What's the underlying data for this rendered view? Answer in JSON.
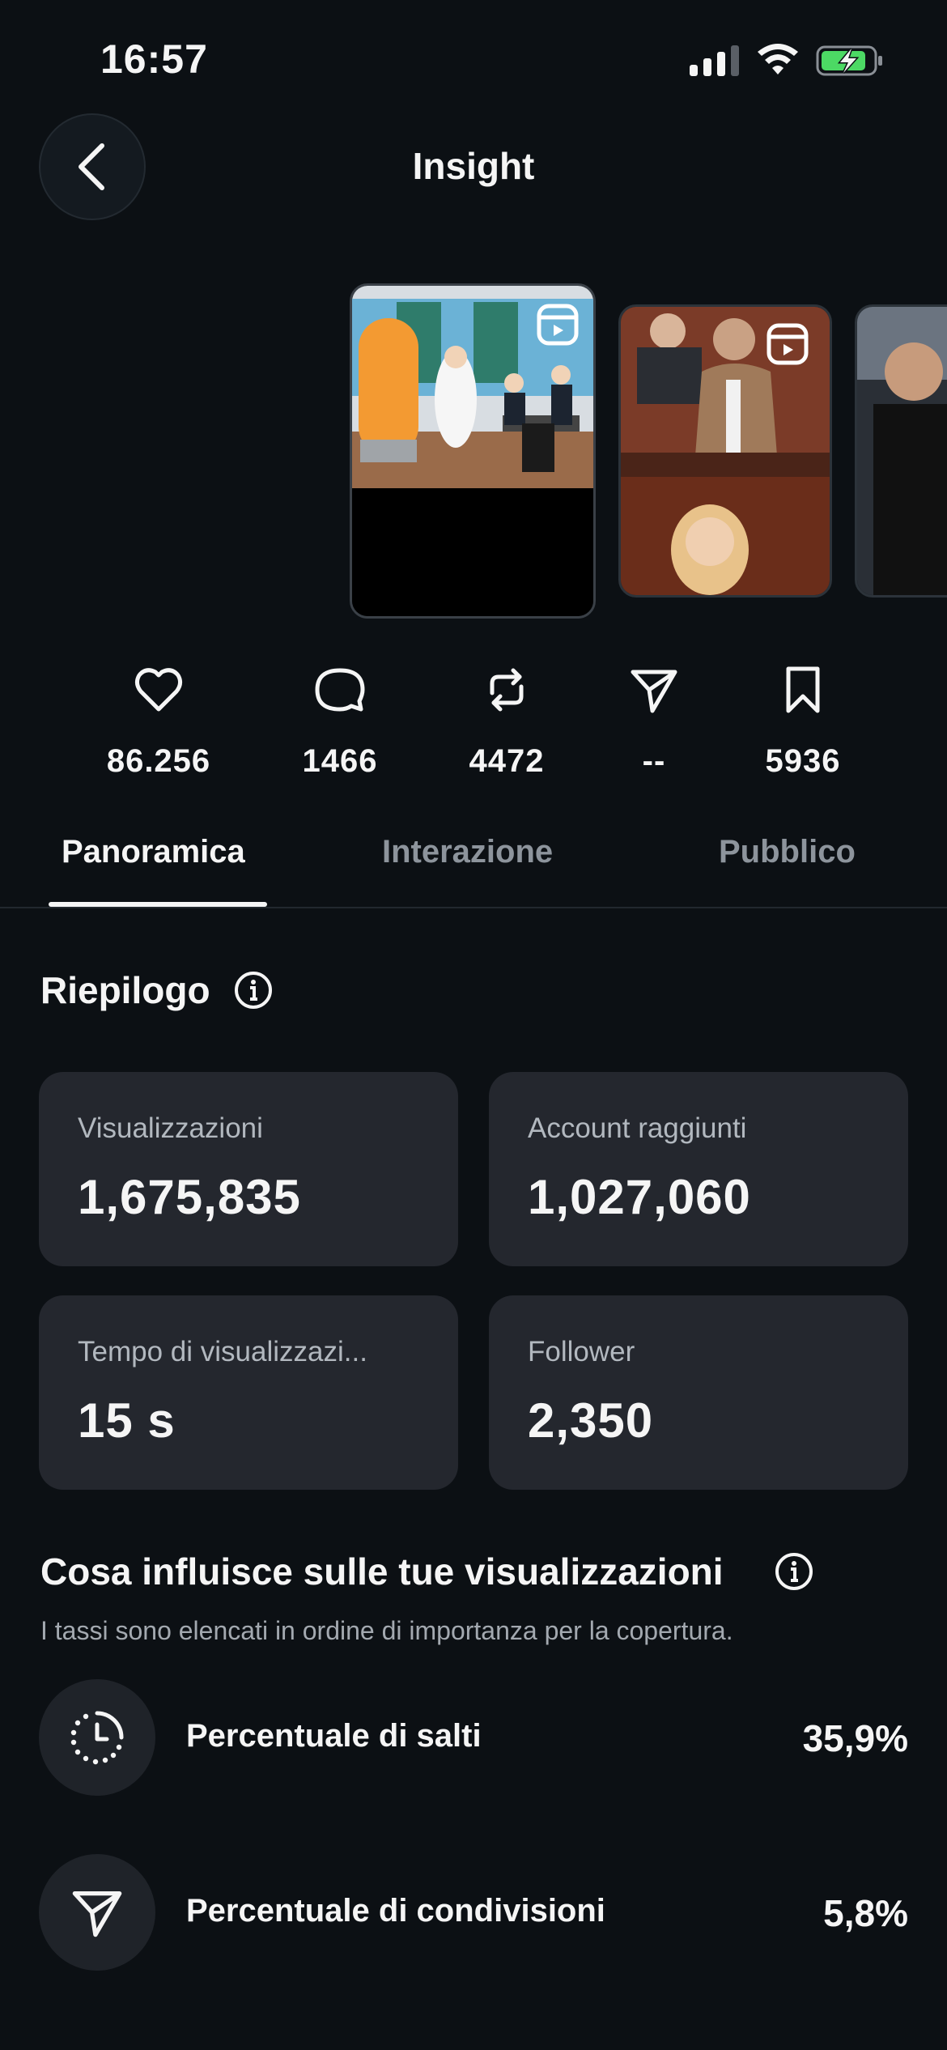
{
  "status_bar": {
    "time": "16:57"
  },
  "header": {
    "title": "Insight"
  },
  "stats": {
    "likes": "86.256",
    "comments": "1466",
    "reposts": "4472",
    "shares": "--",
    "saves": "5936"
  },
  "tabs": [
    "Panoramica",
    "Interazione",
    "Pubblico"
  ],
  "summary": {
    "title": "Riepilogo",
    "cards": [
      {
        "label": "Visualizzazioni",
        "value": "1,675,835"
      },
      {
        "label": "Account raggiunti",
        "value": "1,027,060"
      },
      {
        "label": "Tempo di visualizzazi...",
        "value": "15 s"
      },
      {
        "label": "Follower",
        "value": "2,350"
      }
    ]
  },
  "influence": {
    "title": "Cosa influisce sulle tue visualizzazioni",
    "subtitle": "I tassi sono elencati in ordine di importanza per la copertura.",
    "factors": [
      {
        "label": "Percentuale di salti",
        "value": "35,9%",
        "icon": "clock-dotted-icon"
      },
      {
        "label": "Percentuale di condivisioni",
        "value": "5,8%",
        "icon": "send-icon"
      }
    ]
  },
  "colors": {
    "background": "#0c1014",
    "card": "#24272e",
    "muted_text": "#a3a9b0",
    "battery_green": "#4cd964"
  }
}
